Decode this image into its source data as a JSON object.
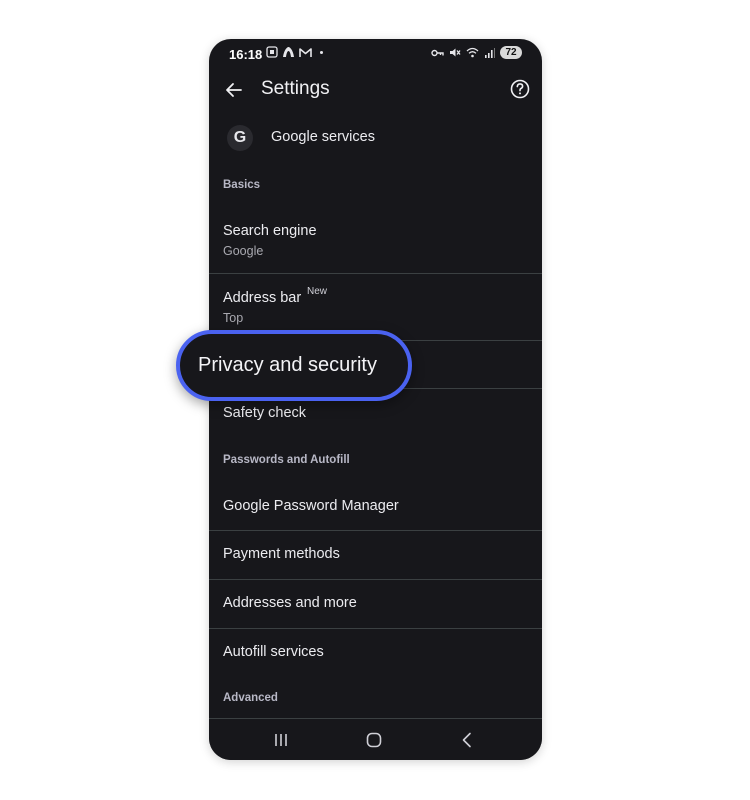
{
  "status_bar": {
    "time": "16:18",
    "battery": "72",
    "icons_left": [
      "screenshot-icon",
      "app-icon",
      "gmail-icon",
      "dot"
    ],
    "icons_right": [
      "vpn-key-icon",
      "mute-icon",
      "wifi-icon",
      "signal-icon"
    ]
  },
  "app_bar": {
    "title": "Settings",
    "back_icon": "arrow-left-icon",
    "help_icon": "help-circle-icon"
  },
  "list": {
    "google_services": {
      "label": "Google services",
      "icon_letter": "G"
    },
    "basics_header": "Basics",
    "search_engine": {
      "label": "Search engine",
      "sub": "Google"
    },
    "address_bar": {
      "label": "Address bar",
      "badge": "New",
      "sub": "Top"
    },
    "safety_check": {
      "label": "Safety check"
    },
    "passwords_header": "Passwords and Autofill",
    "password_manager": {
      "label": "Google Password Manager"
    },
    "payment_methods": {
      "label": "Payment methods"
    },
    "addresses": {
      "label": "Addresses and more"
    },
    "autofill_services": {
      "label": "Autofill services"
    },
    "advanced_header": "Advanced"
  },
  "callout": {
    "label": "Privacy and security",
    "border_color": "#4a62f0"
  },
  "nav_bar": {
    "items": [
      "recent-apps-icon",
      "home-icon",
      "back-icon"
    ]
  },
  "colors": {
    "background": "#17171b",
    "divider": "#3b4042",
    "accent": "#4a62f0"
  }
}
